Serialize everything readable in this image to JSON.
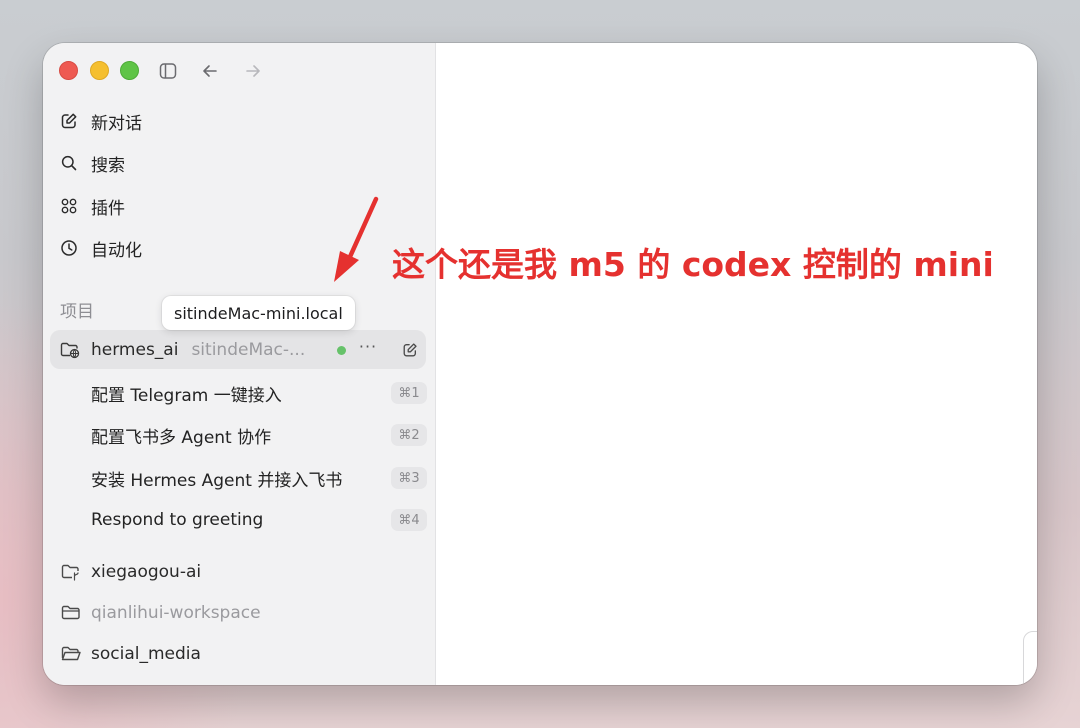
{
  "window": {
    "nav": {
      "back_icon": "arrow-left-icon",
      "forward_icon": "arrow-right-icon",
      "sidebar_toggle_icon": "sidebar-toggle-icon"
    }
  },
  "sidebar": {
    "menu": [
      {
        "label": "新对话",
        "icon": "compose-icon"
      },
      {
        "label": "搜索",
        "icon": "search-icon"
      },
      {
        "label": "插件",
        "icon": "plugins-grid-icon"
      },
      {
        "label": "自动化",
        "icon": "clock-icon"
      }
    ],
    "projects_label": "项目",
    "tooltip": "sitindeMac-mini.local",
    "active_project": {
      "name": "hermes_ai",
      "host": "sitindeMac-...",
      "status_color": "#66c26a",
      "more_label": "···",
      "icon": "remote-folder-icon"
    },
    "chats": [
      {
        "title": "配置 Telegram 一键接入",
        "shortcut": "⌘1"
      },
      {
        "title": "配置飞书多 Agent 协作",
        "shortcut": "⌘2"
      },
      {
        "title": "安装 Hermes Agent 并接入飞书",
        "shortcut": "⌘3"
      },
      {
        "title": "Respond to greeting",
        "shortcut": "⌘4"
      }
    ],
    "folders": [
      {
        "name": "xiegaogou-ai",
        "icon": "branch-folder-icon",
        "muted": false
      },
      {
        "name": "qianlihui-workspace",
        "icon": "folder-icon",
        "muted": true
      },
      {
        "name": "social_media",
        "icon": "folder-open-icon",
        "muted": false
      }
    ]
  },
  "annotation": {
    "text": "这个还是我 m5 的 codex 控制的 mini",
    "color": "#e5312f"
  }
}
